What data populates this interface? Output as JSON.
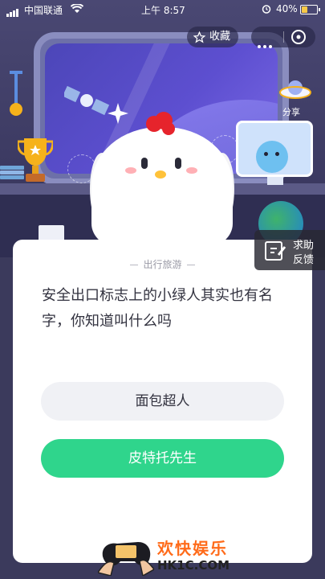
{
  "status_bar": {
    "carrier": "中国联通",
    "time": "上午 8:57",
    "battery": "40%",
    "battery_level": 0.4
  },
  "top_actions": {
    "favorite_label": "收藏"
  },
  "scene": {
    "share_label": "分享"
  },
  "feedback": {
    "line1": "求助",
    "line2": "反馈"
  },
  "quiz": {
    "category": "出行旅游",
    "question": "安全出口标志上的小绿人其实也有名字，你知道叫什么吗",
    "options": [
      {
        "label": "面包超人"
      },
      {
        "label": "皮特托先生"
      }
    ]
  },
  "watermark": {
    "title": "欢快娱乐",
    "domain": "HK1C.COM"
  },
  "colors": {
    "accent_green": "#2fd58c",
    "option_bg": "#f0f1f5",
    "watermark_orange": "#ff6b1a"
  }
}
